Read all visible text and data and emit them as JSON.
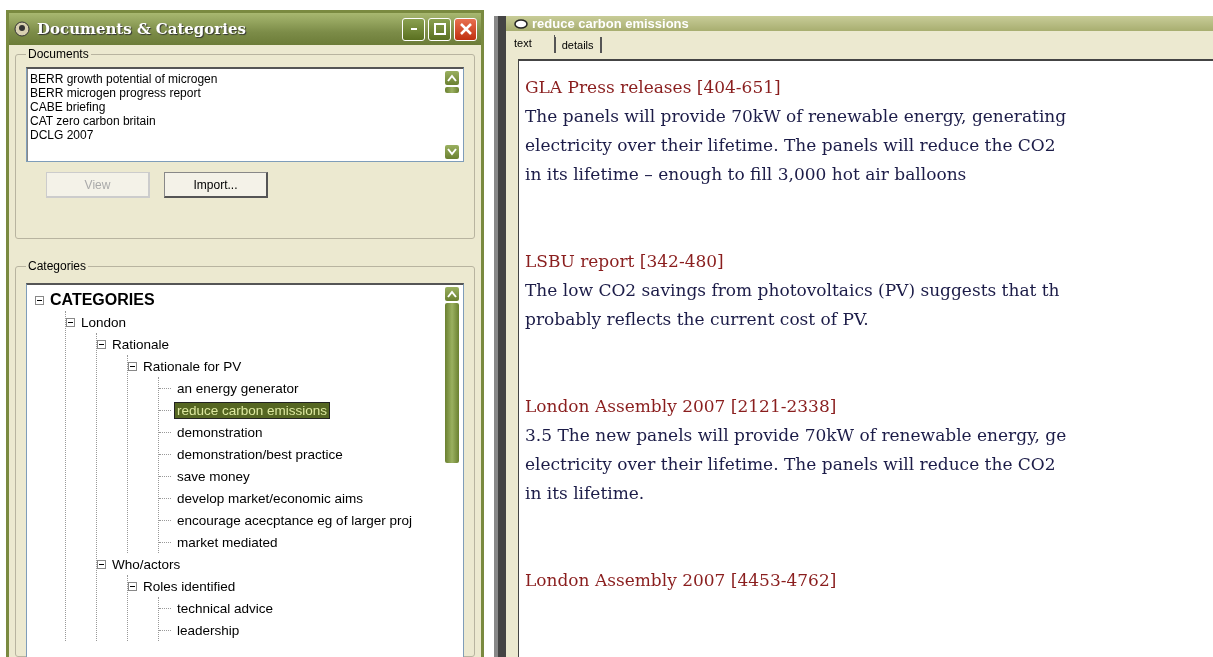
{
  "left_window": {
    "title": "Documents & Categories"
  },
  "documents": {
    "label": "Documents",
    "items": [
      "BERR growth potential of microgen",
      "BERR microgen progress report",
      "CABE briefing",
      "CAT zero carbon britain",
      "DCLG 2007"
    ],
    "buttons": [
      {
        "label": "View",
        "disabled": true
      },
      {
        "label": "Import...",
        "disabled": false
      }
    ]
  },
  "categories": {
    "label": "Categories",
    "tree": [
      {
        "label": "CATEGORIES",
        "expanded": true,
        "selected": false,
        "children": [
          {
            "label": "London",
            "expanded": true,
            "selected": false,
            "children": [
              {
                "label": "Rationale",
                "expanded": true,
                "selected": false,
                "children": [
                  {
                    "label": "Rationale for PV",
                    "expanded": true,
                    "selected": false,
                    "children": [
                      {
                        "label": "an energy generator",
                        "selected": false
                      },
                      {
                        "label": "reduce carbon emissions",
                        "selected": true
                      },
                      {
                        "label": "demonstration",
                        "selected": false
                      },
                      {
                        "label": "demonstration/best practice",
                        "selected": false
                      },
                      {
                        "label": "save money",
                        "selected": false
                      },
                      {
                        "label": "develop market/economic aims",
                        "selected": false
                      },
                      {
                        "label": "encourage acecptance eg of larger proj",
                        "selected": false
                      },
                      {
                        "label": "market mediated",
                        "selected": false
                      }
                    ]
                  }
                ]
              },
              {
                "label": "Who/actors",
                "expanded": true,
                "selected": false,
                "children": [
                  {
                    "label": "Roles identified",
                    "expanded": true,
                    "selected": false,
                    "children": [
                      {
                        "label": "technical advice",
                        "selected": false
                      },
                      {
                        "label": "leadership",
                        "selected": false
                      }
                    ]
                  }
                ]
              }
            ]
          }
        ]
      }
    ]
  },
  "right_window": {
    "title": "reduce carbon emissions"
  },
  "tabs": [
    {
      "label": "text",
      "selected": true
    },
    {
      "label": "details",
      "selected": false
    }
  ],
  "passages": [
    {
      "source": "GLA Press releases [404-651]",
      "lines": [
        "The panels will provide 70kW of renewable energy, generating",
        "electricity over their lifetime. The panels will reduce the CO2",
        "in its lifetime – enough to fill 3,000 hot air balloons"
      ]
    },
    {
      "source": "LSBU report [342-480]",
      "lines": [
        "The low CO2 savings from photovoltaics (PV) suggests that th",
        "probably reflects the current cost of PV."
      ]
    },
    {
      "source": "London Assembly 2007 [2121-2338]",
      "lines": [
        "3.5 The new panels will provide 70kW of renewable energy, ge",
        "electricity over their lifetime. The panels will reduce the CO2",
        "in its lifetime."
      ]
    },
    {
      "source": "London Assembly 2007 [4453-4762]"
    }
  ]
}
